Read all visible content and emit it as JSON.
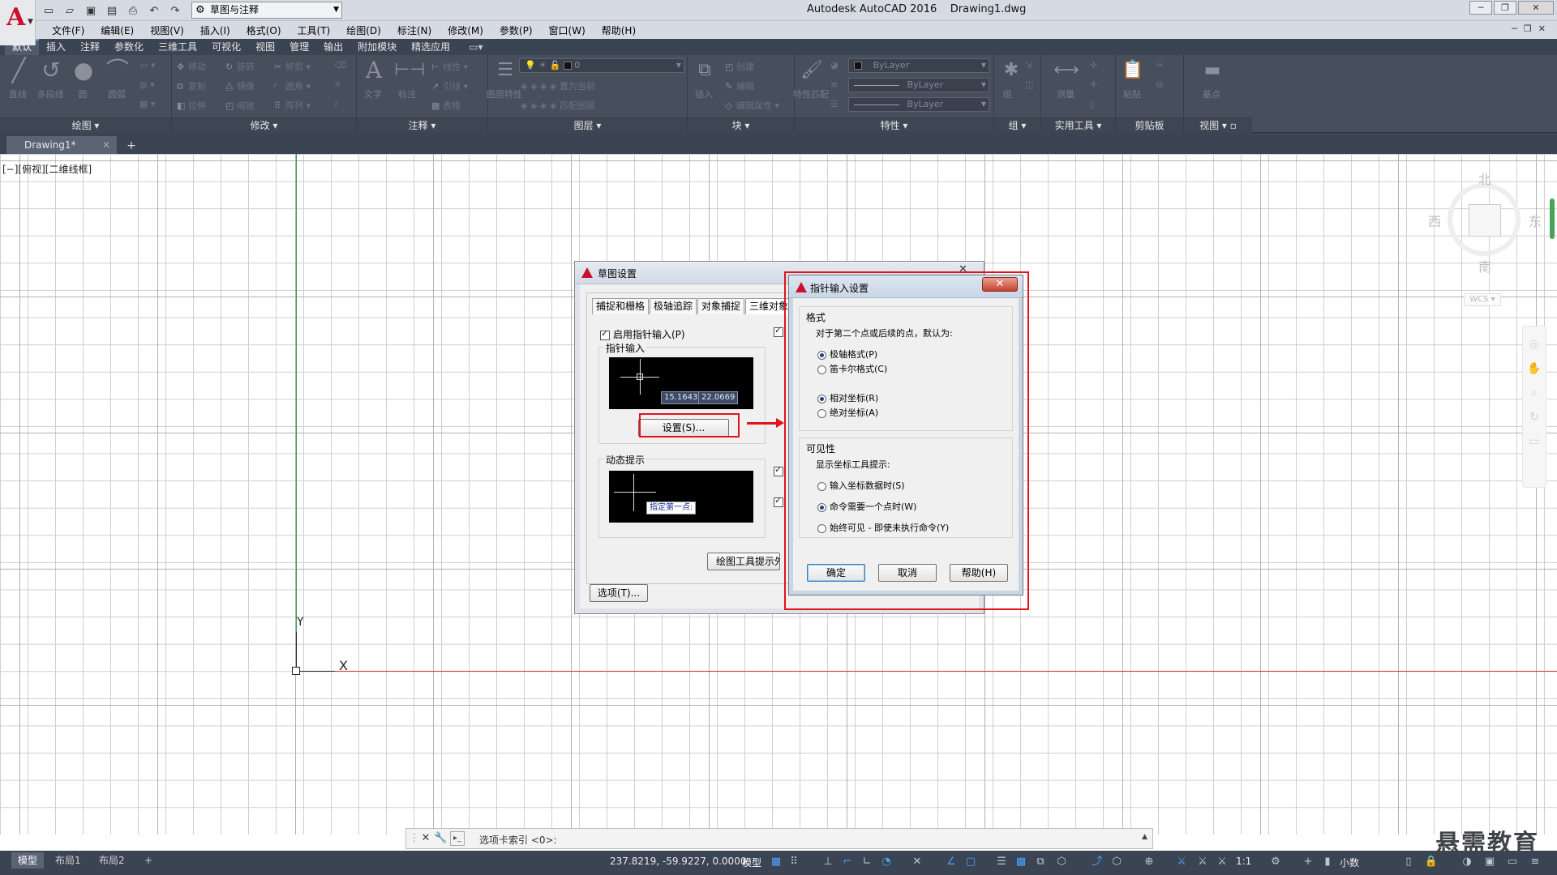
{
  "titlebar": {
    "workspace": "草图与注释",
    "app_name": "Autodesk AutoCAD 2016",
    "file_name": "Drawing1.dwg"
  },
  "menu": [
    "文件(F)",
    "编辑(E)",
    "视图(V)",
    "插入(I)",
    "格式(O)",
    "工具(T)",
    "绘图(D)",
    "标注(N)",
    "修改(M)",
    "参数(P)",
    "窗口(W)",
    "帮助(H)"
  ],
  "ribbon_tabs": [
    "默认",
    "插入",
    "注释",
    "参数化",
    "三维工具",
    "可视化",
    "视图",
    "管理",
    "输出",
    "附加模块",
    "精选应用"
  ],
  "ribbon": {
    "draw": {
      "title": "绘图",
      "line": "直线",
      "polyline": "多段线",
      "circle": "圆",
      "arc": "圆弧"
    },
    "modify": {
      "title": "修改",
      "move": "移动",
      "rotate": "旋转",
      "trim": "修剪",
      "copy": "复制",
      "mirror": "镜像",
      "fillet": "圆角",
      "stretch": "拉伸",
      "scale": "缩放",
      "array": "阵列"
    },
    "annotation": {
      "title": "注释",
      "text": "文字",
      "dimension": "标注",
      "linear": "线性",
      "leader": "引线",
      "table": "表格"
    },
    "layers": {
      "title": "图层",
      "layer_props": "图层特性",
      "current_layer": "0",
      "set_current": "置为当前",
      "match_layer": "匹配图层"
    },
    "block": {
      "title": "块",
      "insert": "插入",
      "create": "创建",
      "edit": "编辑",
      "edit_attributes": "编辑属性"
    },
    "properties": {
      "title": "特性",
      "match": "特性匹配",
      "color": "ByLayer",
      "linetype": "ByLayer",
      "lineweight": "ByLayer"
    },
    "groups": {
      "title": "组",
      "group": "组"
    },
    "utilities": {
      "title": "实用工具",
      "measure": "测量"
    },
    "clipboard": {
      "title": "剪贴板",
      "paste": "粘贴"
    },
    "view": {
      "title": "视图",
      "base": "基点"
    }
  },
  "file_tab": {
    "name": "Drawing1*"
  },
  "canvas": {
    "viewport_label": "[−][俯视][二维线框]",
    "ucs_x": "X",
    "ucs_y": "Y",
    "compass": {
      "north": "北",
      "south": "南",
      "east": "东",
      "west": "西"
    },
    "wcs": "WCS"
  },
  "drafting_dialog": {
    "title": "草图设置",
    "tabs": [
      "捕捉和栅格",
      "极轴追踪",
      "对象捕捉",
      "三维对象"
    ],
    "enable_pointer": "启用指针输入(P)",
    "pointer_group": "指针输入",
    "preview_values": [
      "15.1643",
      "22.0669"
    ],
    "settings_button": "设置(S)...",
    "dynamic_prompt_group": "动态提示",
    "dynamic_prompt_text": "指定第一点:",
    "tooltip_appearance": "绘图工具提示外",
    "options_button": "选项(T)..."
  },
  "pointer_dialog": {
    "title": "指针输入设置",
    "format_title": "格式",
    "format_desc": "对于第二个点或后续的点，默认为:",
    "polar": "极轴格式(P)",
    "cartesian": "笛卡尔格式(C)",
    "relative": "相对坐标(R)",
    "absolute": "绝对坐标(A)",
    "visibility_title": "可见性",
    "visibility_desc": "显示坐标工具提示:",
    "vis_option1": "输入坐标数据时(S)",
    "vis_option2": "命令需要一个点时(W)",
    "vis_option3": "始终可见 - 即使未执行命令(Y)",
    "ok": "确定",
    "cancel": "取消",
    "help": "帮助(H)"
  },
  "command_line": {
    "prompt_text": "选项卡索引 <0>:"
  },
  "status": {
    "layout_tabs": [
      "模型",
      "布局1",
      "布局2"
    ],
    "coords": "237.8219, -59.9227, 0.0000",
    "model": "模型",
    "scale": "1:1",
    "units": "小数"
  },
  "watermark": "悬需教育"
}
